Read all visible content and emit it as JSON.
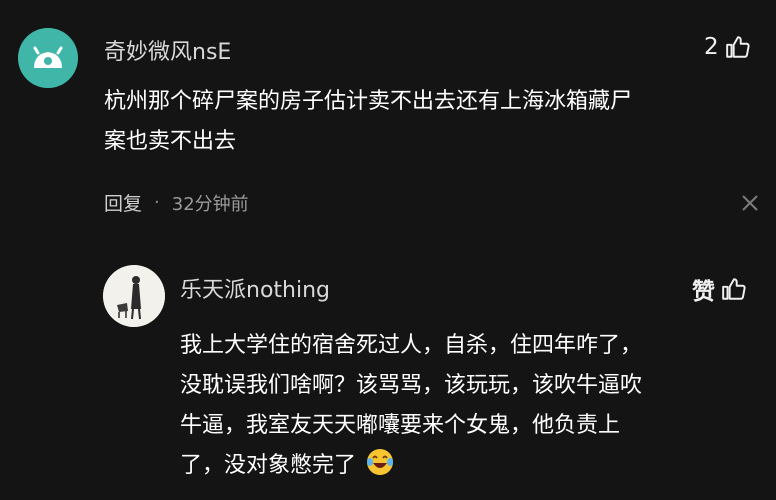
{
  "comments": [
    {
      "username": "奇妙微风nsE",
      "text_lines": [
        "杭州那个碎尸案的房子估计卖不出去还有上海冰箱藏尸",
        "案也卖不出去"
      ],
      "like_count": "2",
      "reply_label": "回复",
      "separator": "·",
      "time": "32分钟前",
      "avatar": "teal-robot-avatar"
    },
    {
      "username": "乐天派nothing",
      "text_lines": [
        "我上大学住的宿舍死过人，自杀，住四年咋了，",
        "没耽误我们啥啊？该骂骂，该玩玩，该吹牛逼吹",
        "牛逼，我室友天天嘟囔要来个女鬼，他负责上",
        "了，没对象憋完了"
      ],
      "like_label": "赞",
      "avatar": "sketch-figure-avatar",
      "emoji": "laughing-crying-emoji"
    }
  ],
  "icons": {
    "like": "thumbs-up-icon",
    "close": "close-icon"
  },
  "colors": {
    "background": "#141414",
    "teal_avatar": "#3fb6a8",
    "emoji": "#f7c531"
  }
}
